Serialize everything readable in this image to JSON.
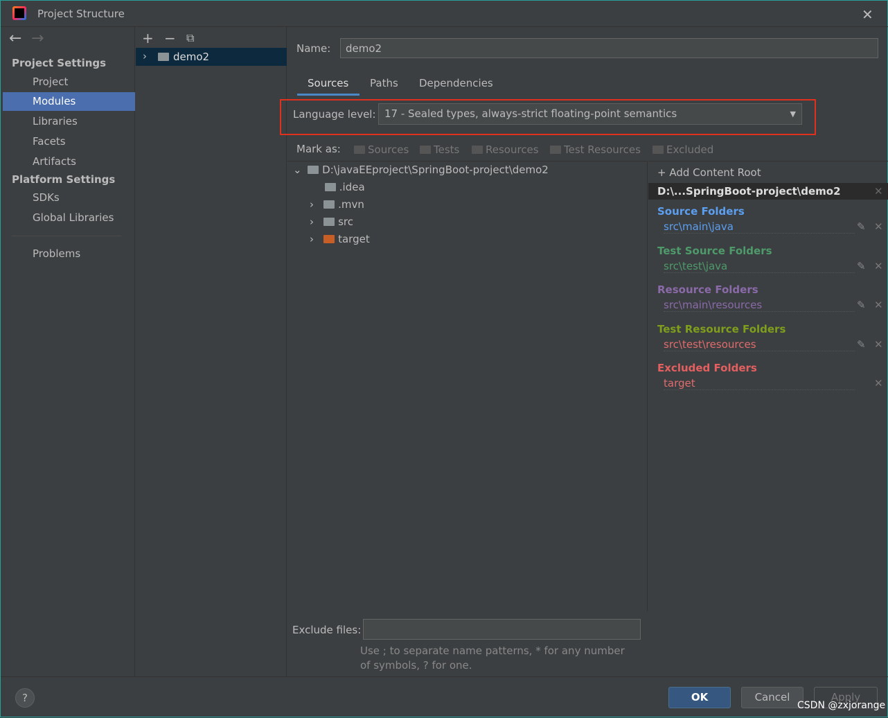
{
  "window": {
    "title": "Project Structure",
    "close_icon": "close-icon"
  },
  "sidebar": {
    "project_settings": "Project Settings",
    "items1": [
      "Project",
      "Modules",
      "Libraries",
      "Facets",
      "Artifacts"
    ],
    "platform_settings": "Platform Settings",
    "items2": [
      "SDKs",
      "Global Libraries"
    ],
    "problems": "Problems",
    "selected": "Modules"
  },
  "modules": {
    "toolbar": [
      "add-icon",
      "remove-icon",
      "copy-icon"
    ],
    "items": [
      "demo2"
    ]
  },
  "main": {
    "name_label": "Name:",
    "name_value": "demo2",
    "tabs": [
      "Sources",
      "Paths",
      "Dependencies"
    ],
    "active_tab": "Sources",
    "language_label": "Language level:",
    "language_value": "17 - Sealed types, always-strict floating-point semantics",
    "mark_as": "Mark as:",
    "mark_buttons": [
      "Sources",
      "Tests",
      "Resources",
      "Test Resources",
      "Excluded"
    ],
    "tree": {
      "root": "D:\\javaEEproject\\SpringBoot-project\\demo2",
      "children": [
        ".idea",
        ".mvn",
        "src",
        "target"
      ]
    },
    "exclude_label": "Exclude files:",
    "exclude_value": "",
    "hint": "Use ; to separate name patterns, * for any number of symbols, ? for one."
  },
  "content_roots": {
    "add": "Add Content Root",
    "root": "D:\\...SpringBoot-project\\demo2",
    "groups": [
      {
        "title": "Source Folders",
        "path": "src\\main\\java",
        "color": "#5c9ff0",
        "path_color": "#5c9ff0"
      },
      {
        "title": "Test Source Folders",
        "path": "src\\test\\java",
        "color": "#4e9a6a",
        "path_color": "#4e9a6a"
      },
      {
        "title": "Resource Folders",
        "path": "src\\main\\resources",
        "color": "#8a6aa8",
        "path_color": "#8a6aa8"
      },
      {
        "title": "Test Resource Folders",
        "path": "src\\test\\resources",
        "color": "#7f9f1c",
        "path_color": "#e06c6c"
      },
      {
        "title": "Excluded Folders",
        "path": "target",
        "color": "#e45f5f",
        "path_color": "#e06c6c"
      }
    ]
  },
  "footer": {
    "help": "?",
    "ok": "OK",
    "cancel": "Cancel",
    "apply": "Apply",
    "watermark": "CSDN @zxjorange"
  }
}
